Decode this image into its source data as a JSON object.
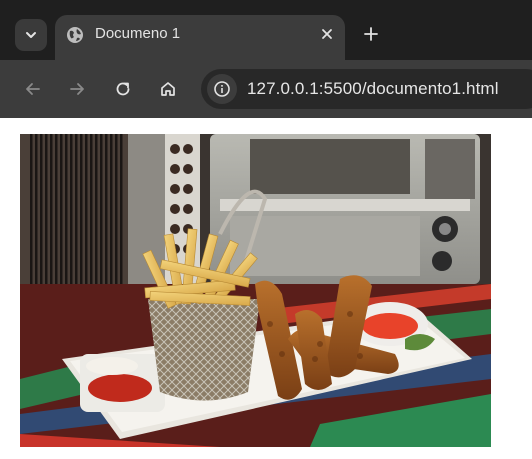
{
  "browser": {
    "tabs": [
      {
        "title": "Documeno 1",
        "favicon": "globe-icon"
      }
    ],
    "address": {
      "url": "127.0.0.1:5500/documento1.html"
    },
    "icons": {
      "tab_menu": "chevron-down-icon",
      "close_tab": "close-icon",
      "new_tab": "plus-icon",
      "back": "arrow-left-icon",
      "forward": "arrow-right-icon",
      "reload": "reload-icon",
      "home": "home-icon",
      "site_info": "info-icon"
    }
  },
  "colors": {
    "tabstrip": "#1f1f1f",
    "toolbar": "#3c3c3c",
    "omnibox": "#282828",
    "text": "#e3e3e3"
  }
}
